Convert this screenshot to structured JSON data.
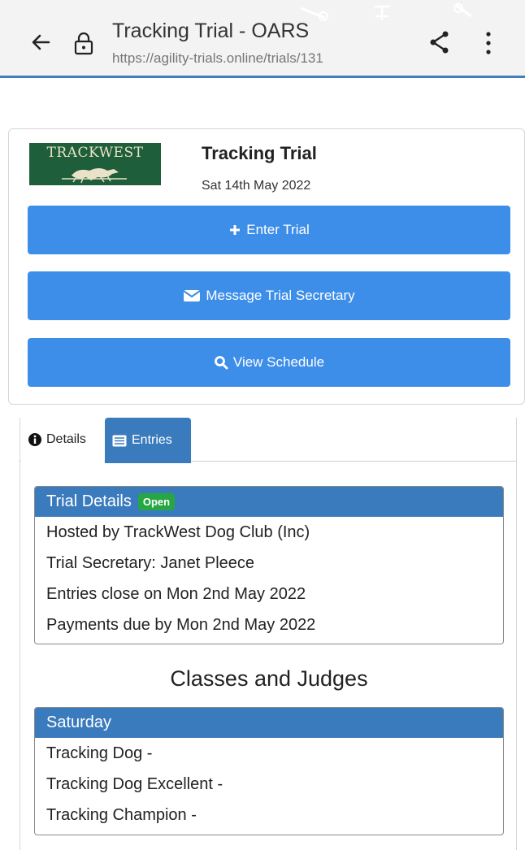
{
  "browser": {
    "title": "Tracking Trial - OARS",
    "url": "https://agility-trials.online/trials/131",
    "icons": [
      "back-arrow-icon",
      "lock-icon",
      "share-icon",
      "more-vert-icon"
    ]
  },
  "trial": {
    "logo_text": "TRACKWEST",
    "name": "Tracking Trial",
    "date": "Sat 14th May 2022",
    "buttons": {
      "enter": "Enter Trial",
      "message": "Message Trial Secretary",
      "schedule": "View Schedule"
    }
  },
  "tabs": {
    "details": "Details",
    "entries": "Entries",
    "active": "Entries"
  },
  "details": {
    "heading": "Trial Details",
    "badge": "Open",
    "items": [
      "Hosted by TrackWest Dog Club (Inc)",
      "Trial Secretary: Janet Pleece",
      "Entries close on Mon 2nd May 2022",
      "Payments due by Mon 2nd May 2022"
    ]
  },
  "classes": {
    "title": "Classes and Judges",
    "day": "Saturday",
    "items": [
      "Tracking Dog -",
      "Tracking Dog Excellent -",
      "Tracking Champion -"
    ]
  },
  "colors": {
    "primary_button": "#3d8ee9",
    "header_blue": "#3a7bbd",
    "badge_green": "#27a744",
    "logo_green": "#1e5e3a"
  }
}
